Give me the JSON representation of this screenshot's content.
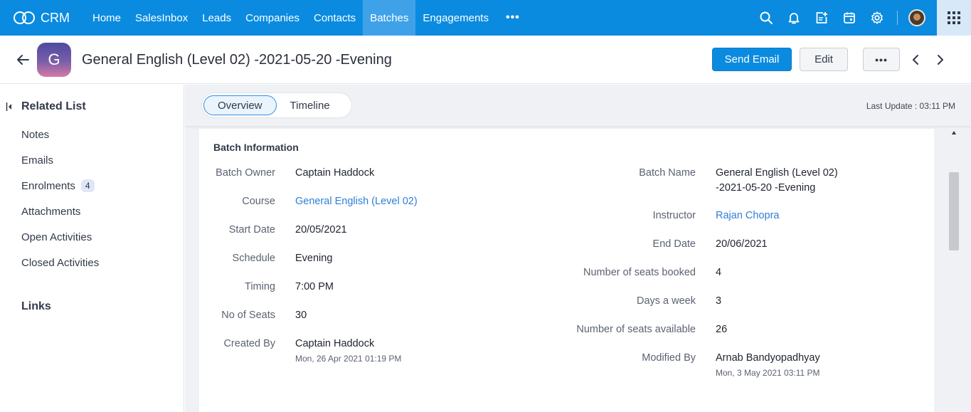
{
  "topnav": {
    "brand": "CRM",
    "items": [
      {
        "label": "Home",
        "active": false
      },
      {
        "label": "SalesInbox",
        "active": false
      },
      {
        "label": "Leads",
        "active": false
      },
      {
        "label": "Companies",
        "active": false
      },
      {
        "label": "Contacts",
        "active": false
      },
      {
        "label": "Batches",
        "active": true
      },
      {
        "label": "Engagements",
        "active": false
      }
    ],
    "more": "•••",
    "icons": [
      "search-icon",
      "bell-icon",
      "add-note-icon",
      "calendar-icon",
      "gear-icon",
      "user-avatar",
      "apps-grid-icon"
    ],
    "accent_color": "#0a8be0"
  },
  "header": {
    "avatar_letter": "G",
    "title": "General English (Level 02) -2021-05-20 -Evening",
    "send_email_label": "Send Email",
    "edit_label": "Edit",
    "more_label": "•••"
  },
  "sidebar": {
    "related_heading": "Related List",
    "items": [
      {
        "label": "Notes"
      },
      {
        "label": "Emails"
      },
      {
        "label": "Enrolments",
        "badge": "4"
      },
      {
        "label": "Attachments"
      },
      {
        "label": "Open Activities"
      },
      {
        "label": "Closed Activities"
      }
    ],
    "links_heading": "Links"
  },
  "main": {
    "tabs": [
      {
        "label": "Overview",
        "active": true
      },
      {
        "label": "Timeline",
        "active": false
      }
    ],
    "last_update": "Last Update : 03:11 PM",
    "section_title": "Batch Information",
    "left_fields": [
      {
        "label": "Batch Owner",
        "value": "Captain Haddock"
      },
      {
        "label": "Course",
        "value": "General English (Level 02)"
      },
      {
        "label": "Start Date",
        "value": "20/05/2021"
      },
      {
        "label": "Schedule",
        "value": "Evening"
      },
      {
        "label": "Timing",
        "value": "7:00 PM"
      },
      {
        "label": "No of Seats",
        "value": "30"
      },
      {
        "label": "Created By",
        "value": "Captain Haddock",
        "sub": "Mon, 26 Apr 2021 01:19 PM"
      }
    ],
    "right_fields": [
      {
        "label": "Batch Name",
        "value_line1": "General English (Level 02)",
        "value_line2": "-2021-05-20 -Evening"
      },
      {
        "label": "Instructor",
        "value": "Rajan Chopra"
      },
      {
        "label": "End Date",
        "value": "20/06/2021"
      },
      {
        "label": "Number of seats booked",
        "value": "4"
      },
      {
        "label": "Days a week",
        "value": "3"
      },
      {
        "label": "Number of seats available",
        "value": "26"
      },
      {
        "label": "Modified By",
        "value": "Arnab Bandyopadhyay",
        "sub": "Mon, 3 May 2021 03:11 PM"
      }
    ]
  }
}
